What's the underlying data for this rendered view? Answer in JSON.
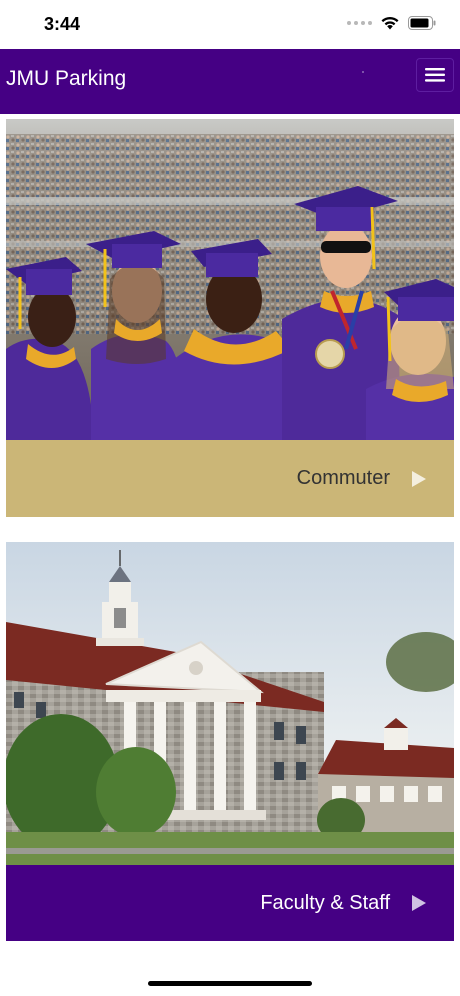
{
  "status_bar": {
    "time": "3:44"
  },
  "header": {
    "title": "JMU Parking",
    "menu_icon": "hamburger-menu-icon",
    "background_color": "#450084"
  },
  "cards": [
    {
      "label": "Commuter",
      "image": "graduates-photo",
      "footer_color": "#CBB677",
      "text_color": "#333333",
      "arrow_icon": "play-arrow-icon"
    },
    {
      "label": "Faculty & Staff",
      "image": "campus-building-photo",
      "footer_color": "#450084",
      "text_color": "#ffffff",
      "arrow_icon": "play-arrow-icon"
    }
  ]
}
